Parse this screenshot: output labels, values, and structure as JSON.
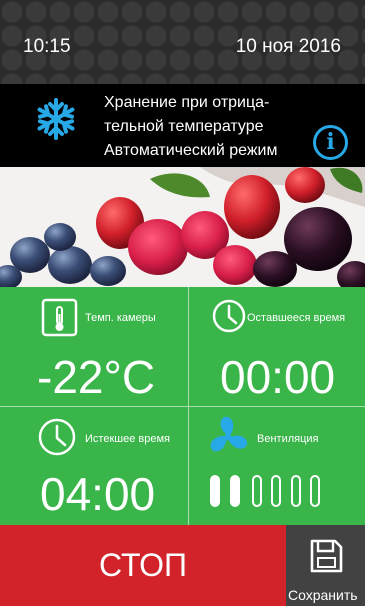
{
  "status_bar": {
    "time": "10:15",
    "date": "10 ноя 2016"
  },
  "program": {
    "line1": "Хранение при отрица-",
    "line2": "тельной температуре",
    "line3": "Автоматический режим",
    "info_symbol": "i",
    "icons": [
      "snowflake-icon",
      "info-icon"
    ],
    "accent_color": "#27a9e8"
  },
  "tiles": {
    "chamber_temp": {
      "label": "Темп. камеры",
      "value": "-22°C",
      "icon": "thermometer-icon"
    },
    "remaining_time": {
      "label": "Оставшееся время",
      "value": "00:00",
      "icon": "clock-icon"
    },
    "elapsed_time": {
      "label": "Истекшее время",
      "value": "04:00",
      "icon": "clock-icon"
    },
    "ventilation": {
      "label": "Вентиляция",
      "level_active": 2,
      "level_total": 6,
      "icon": "fan-icon"
    },
    "background_color": "#3ab54a"
  },
  "actions": {
    "stop_label": "СТОП",
    "stop_color": "#d2232a",
    "save_label": "Сохранить",
    "save_icon": "floppy-disk-icon"
  }
}
